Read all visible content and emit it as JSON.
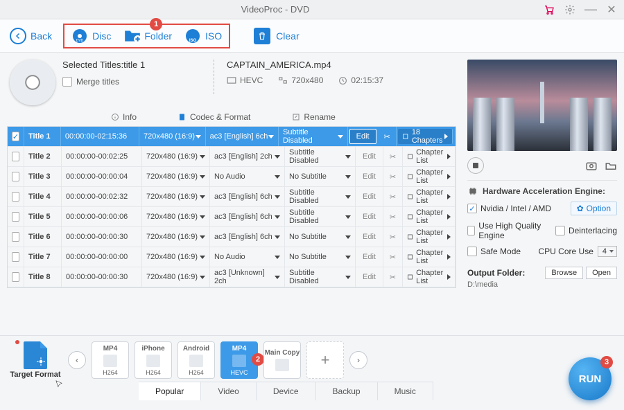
{
  "titlebar": {
    "title": "VideoProc - DVD"
  },
  "toolbar": {
    "back": "Back",
    "disc": "Disc",
    "folder": "Folder",
    "iso": "ISO",
    "clear": "Clear",
    "badge1": "1"
  },
  "source": {
    "selected_titles": "Selected Titles:title 1",
    "merge": "Merge titles",
    "filename": "CAPTAIN_AMERICA.mp4",
    "codec": "HEVC",
    "resolution": "720x480",
    "duration": "02:15:37"
  },
  "tabs": {
    "info": "Info",
    "codec": "Codec & Format",
    "rename": "Rename"
  },
  "titles": [
    {
      "chk": true,
      "name": "Title 1",
      "time": "00:00:00-02:15:36",
      "res": "720x480 (16:9)",
      "aud": "ac3 [English] 6ch",
      "sub": "Subtitle Disabled",
      "edit": "Edit",
      "chap": "18 Chapters"
    },
    {
      "chk": false,
      "name": "Title 2",
      "time": "00:00:00-00:02:25",
      "res": "720x480 (16:9)",
      "aud": "ac3 [English] 2ch",
      "sub": "Subtitle Disabled",
      "edit": "Edit",
      "chap": "Chapter List"
    },
    {
      "chk": false,
      "name": "Title 3",
      "time": "00:00:00-00:00:04",
      "res": "720x480 (16:9)",
      "aud": "No Audio",
      "sub": "No Subtitle",
      "edit": "Edit",
      "chap": "Chapter List"
    },
    {
      "chk": false,
      "name": "Title 4",
      "time": "00:00:00-00:02:32",
      "res": "720x480 (16:9)",
      "aud": "ac3 [English] 6ch",
      "sub": "Subtitle Disabled",
      "edit": "Edit",
      "chap": "Chapter List"
    },
    {
      "chk": false,
      "name": "Title 5",
      "time": "00:00:00-00:00:06",
      "res": "720x480 (16:9)",
      "aud": "ac3 [English] 6ch",
      "sub": "Subtitle Disabled",
      "edit": "Edit",
      "chap": "Chapter List"
    },
    {
      "chk": false,
      "name": "Title 6",
      "time": "00:00:00-00:00:30",
      "res": "720x480 (16:9)",
      "aud": "ac3 [English] 6ch",
      "sub": "No Subtitle",
      "edit": "Edit",
      "chap": "Chapter List"
    },
    {
      "chk": false,
      "name": "Title 7",
      "time": "00:00:00-00:00:00",
      "res": "720x480 (16:9)",
      "aud": "No Audio",
      "sub": "No Subtitle",
      "edit": "Edit",
      "chap": "Chapter List"
    },
    {
      "chk": false,
      "name": "Title 8",
      "time": "00:00:00-00:00:30",
      "res": "720x480 (16:9)",
      "aud": "ac3 [Unknown] 2ch",
      "sub": "Subtitle Disabled",
      "edit": "Edit",
      "chap": "Chapter List"
    }
  ],
  "hw": {
    "title": "Hardware Acceleration Engine:",
    "vendors": "Nvidia / Intel / AMD",
    "option": "Option",
    "hq": "Use High Quality Engine",
    "deint": "Deinterlacing",
    "safe": "Safe Mode",
    "coreuse": "CPU Core Use",
    "corecount": "4"
  },
  "output": {
    "label": "Output Folder:",
    "path": "D:\\media",
    "browse": "Browse",
    "open": "Open"
  },
  "formats": {
    "target": "Target Format",
    "cards": [
      {
        "t1": "MP4",
        "t2": "H264"
      },
      {
        "t1": "iPhone",
        "t2": "H264"
      },
      {
        "t1": "Android",
        "t2": "H264"
      },
      {
        "t1": "MP4",
        "t2": "HEVC",
        "sel": true
      },
      {
        "t1": "Main Copy",
        "t2": "",
        "maincopy": true
      }
    ],
    "badge2": "2",
    "tabs": [
      "Popular",
      "Video",
      "Device",
      "Backup",
      "Music"
    ]
  },
  "run": {
    "label": "RUN",
    "badge": "3"
  }
}
